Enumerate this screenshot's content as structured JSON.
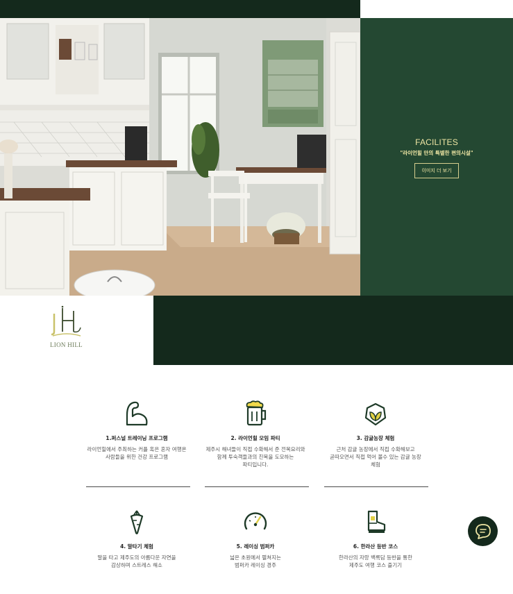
{
  "facilities": {
    "title": "FACILITES",
    "subtitle": "\"라이언힐 만의 특별한 편의시설\"",
    "button_label": "이미지 더 보기"
  },
  "logo": {
    "text": "LION HILL"
  },
  "programs": [
    {
      "title": "1.퍼스널 트레이닝 프로그램",
      "desc": "라이언힐에서 주최하는 커플 혹은 혼자 여행온\n사람들을 위한 건강 프로그램",
      "icon": "flexed-arm-icon"
    },
    {
      "title": "2. 라이언힐 모임 파티",
      "desc": "제주시 해녀들이 직접 수확해서 준 전복요리와\n함께 투숙객들과의 친목을 도모하는\n파티입니다.",
      "icon": "beer-mug-icon"
    },
    {
      "title": "3. 감귤농장 체험",
      "desc": "근처 감귤 농장에서 직접 수확해보고\n곧따오면서 직접 먹어 볼수 있는 감귤 농장\n체험",
      "icon": "leaf-sprout-icon"
    },
    {
      "title": "4. 말타기 체험",
      "desc": "말을 타고 제주도의 아름다운 자연을\n감상하며 스트레스 해소",
      "icon": "carrot-icon"
    },
    {
      "title": "5. 레이싱 범퍼카",
      "desc": "넓은 초원에서 펼쳐지는\n범퍼카 레이싱 경주",
      "icon": "speedometer-icon"
    },
    {
      "title": "6. 한라산 등반 코스",
      "desc": "한라산의 자랑 백록담 등반을 통한\n제주도 여행 코스 즐기기",
      "icon": "hiking-boot-icon"
    }
  ],
  "colors": {
    "dark_green": "#14291c",
    "panel_green": "#244832",
    "accent_yellow": "#efe6a4"
  }
}
